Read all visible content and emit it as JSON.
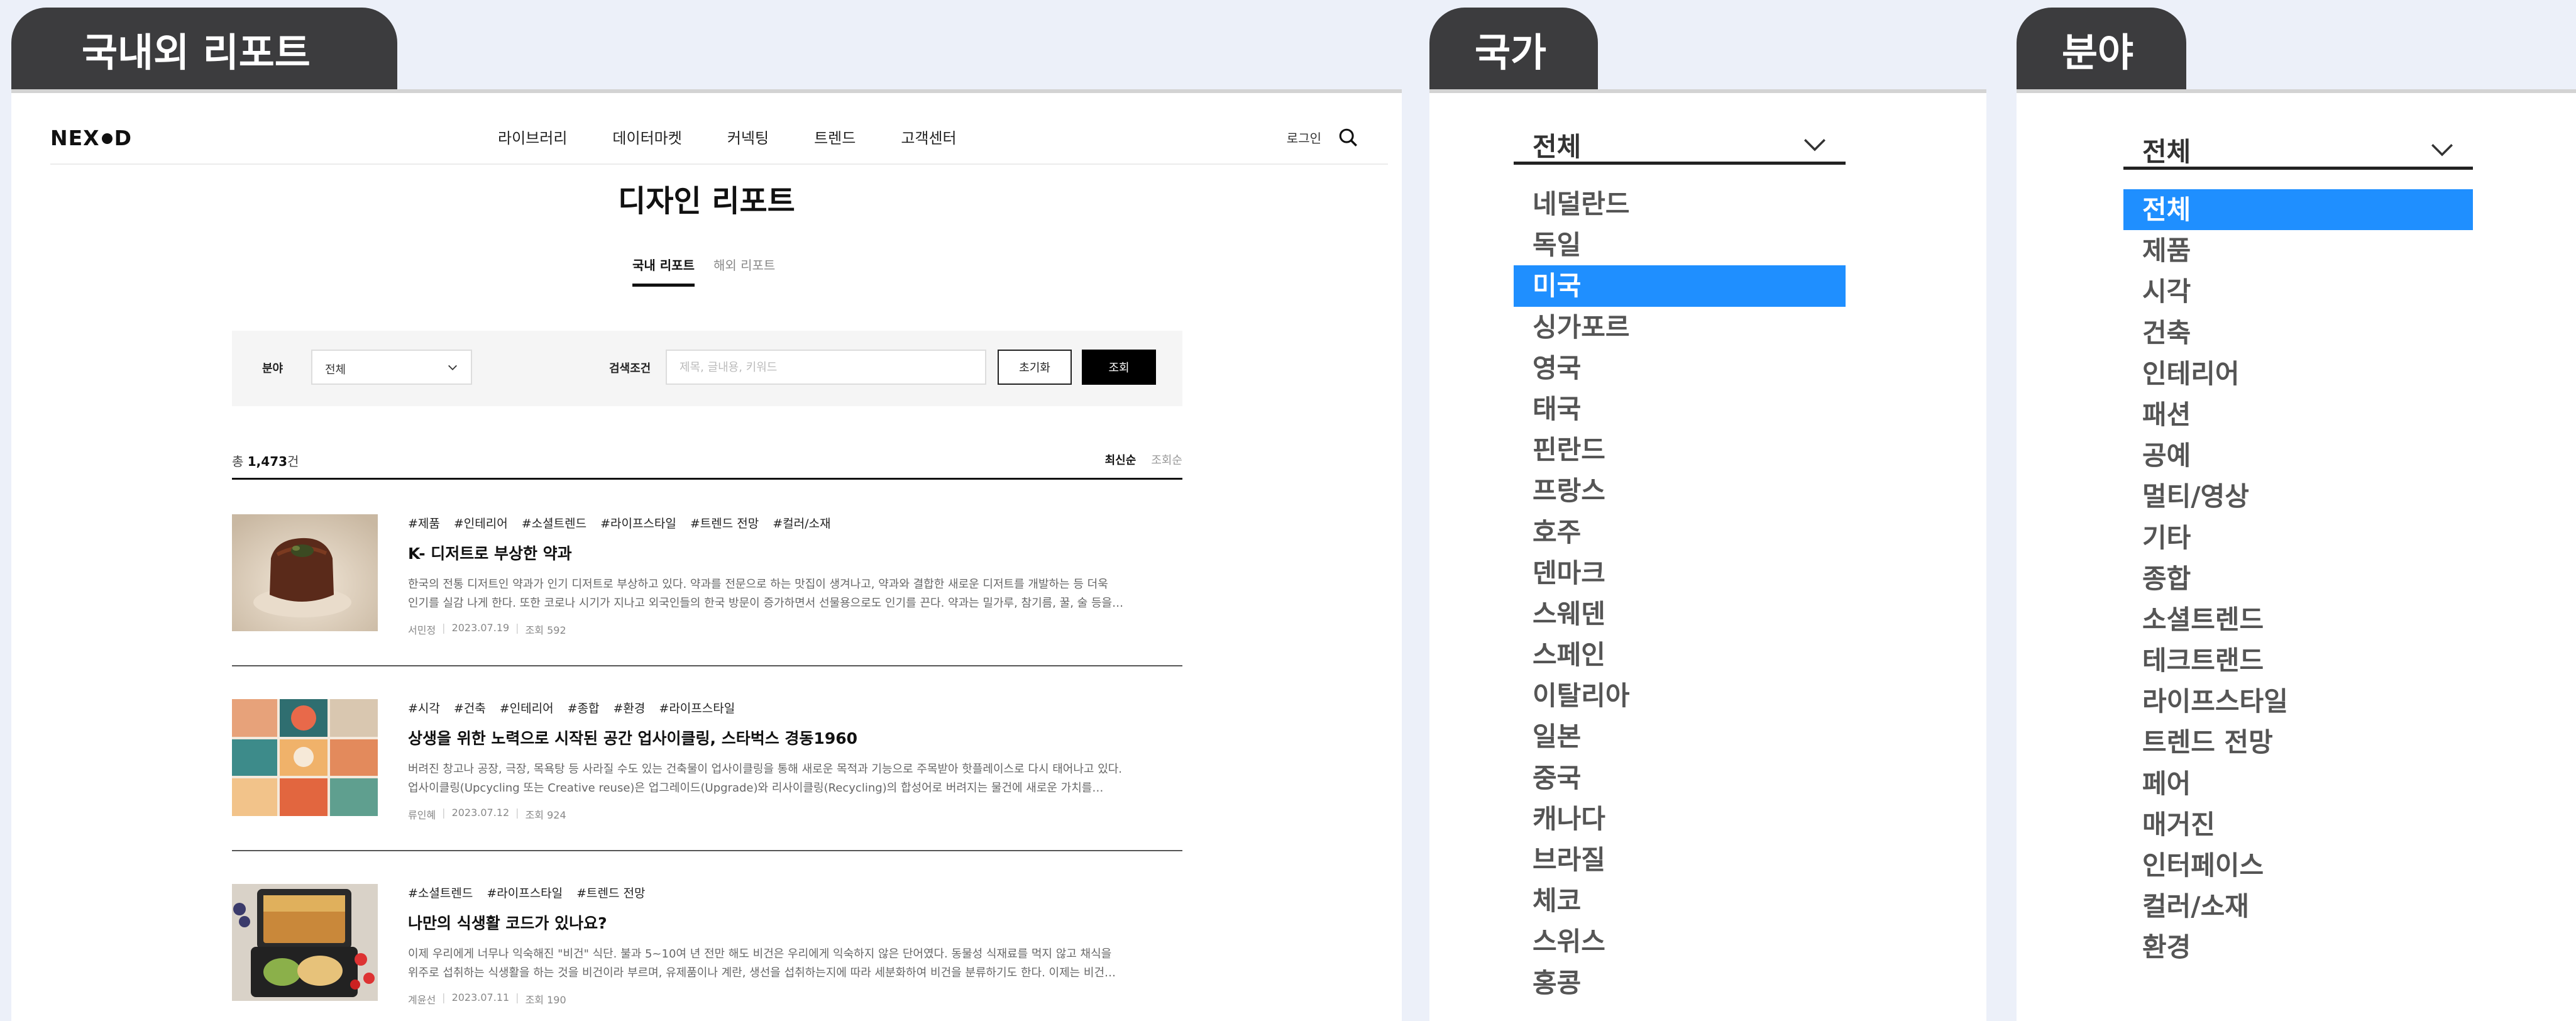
{
  "headers": {
    "reports": "국내외 리포트",
    "country": "국가",
    "field": "분야"
  },
  "site": {
    "logo_left": "NEX",
    "logo_right": "D",
    "menu": [
      "라이브러리",
      "데이터마켓",
      "커넥팅",
      "트렌드",
      "고객센터"
    ],
    "login": "로그인",
    "page_title": "디자인 리포트",
    "tabs": [
      {
        "label": "국내 리포트",
        "active": true
      },
      {
        "label": "해외 리포트",
        "active": false
      }
    ]
  },
  "filter": {
    "field_label": "분야",
    "field_value": "전체",
    "search_label": "검색조건",
    "search_placeholder": "제목, 글내용, 키워드",
    "reset_label": "초기화",
    "search_button": "조회"
  },
  "list": {
    "total_prefix": "총 ",
    "total_count": "1,473",
    "total_suffix": "건",
    "sort_options": [
      {
        "label": "최신순",
        "active": true
      },
      {
        "label": "조회순",
        "active": false
      }
    ],
    "articles": [
      {
        "tags": [
          "#제품",
          "#인테리어",
          "#소셜트렌드",
          "#라이프스타일",
          "#트렌드 전망",
          "#컬러/소재"
        ],
        "title": "K- 디저트로 부상한 약과",
        "desc_line1": "한국의 전통 디저트인 약과가 인기 디저트로 부상하고 있다. 약과를 전문으로 하는 맛집이 생겨나고, 약과와 결합한 새로운 디저트를 개발하는 등 더욱",
        "desc_line2": "인기를 실감 나게 한다. 또한 코로나 시기가 지나고 외국인들의 한국 방문이 증가하면서 선물용으로도 인기를 끈다. 약과는 밀가루, 참기름, 꿀, 술 등을…",
        "author": "서민정",
        "date": "2023.07.19",
        "views": "조회 592"
      },
      {
        "tags": [
          "#시각",
          "#건축",
          "#인테리어",
          "#종합",
          "#환경",
          "#라이프스타일"
        ],
        "title": "상생을 위한 노력으로 시작된 공간 업사이클링, 스타벅스 경동1960",
        "desc_line1": "버려진 창고나 공장, 극장, 목욕탕 등 사라질 수도 있는 건축물이 업사이클링을 통해 새로운 목적과 기능으로 주목받아 핫플레이스로 다시 태어나고 있다.",
        "desc_line2": "업사이클링(Upcycling 또는 Creative reuse)은 업그레이드(Upgrade)와 리사이클링(Recycling)의 합성어로 버려지는 물건에 새로운 가치를…",
        "author": "류인혜",
        "date": "2023.07.12",
        "views": "조회 924"
      },
      {
        "tags": [
          "#소셜트렌드",
          "#라이프스타일",
          "#트렌드 전망"
        ],
        "title": "나만의 식생활 코드가 있나요?",
        "desc_line1": "이제 우리에게 너무나 익숙해진 \"비건\" 식단. 불과 5~10여 년 전만 해도 비건은 우리에게 익숙하지 않은 단어였다. 동물성 식재료를 먹지 않고 채식을",
        "desc_line2": "위주로 섭취하는 식생활을 하는 것을 비건이라 부르며, 유제품이나 계란, 생선을 섭취하는지에 따라 세분화하여 비건을 분류하기도 한다. 이제는 비건…",
        "author": "계윤선",
        "date": "2023.07.11",
        "views": "조회 190"
      }
    ]
  },
  "country_dropdown": {
    "current": "전체",
    "selected": "미국",
    "options": [
      "네덜란드",
      "독일",
      "미국",
      "싱가포르",
      "영국",
      "태국",
      "핀란드",
      "프랑스",
      "호주",
      "덴마크",
      "스웨덴",
      "스페인",
      "이탈리아",
      "일본",
      "중국",
      "캐나다",
      "브라질",
      "체코",
      "스위스",
      "홍콩"
    ]
  },
  "field_dropdown": {
    "current": "전체",
    "selected": "전체",
    "options": [
      "전체",
      "제품",
      "시각",
      "건축",
      "인테리어",
      "패션",
      "공예",
      "멀티/영상",
      "기타",
      "종합",
      "소셜트렌드",
      "테크트랜드",
      "라이프스타일",
      "트렌드 전망",
      "페어",
      "매거진",
      "인터페이스",
      "컬러/소재",
      "환경"
    ]
  },
  "colors": {
    "tab_header": "#3c3c3e",
    "selected_option": "#1f8fff",
    "background": "#ecf0f9"
  }
}
